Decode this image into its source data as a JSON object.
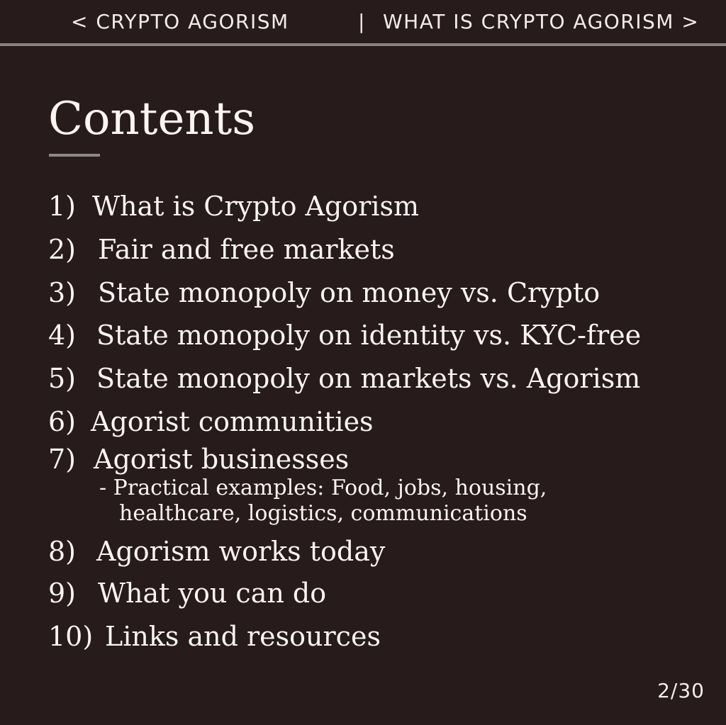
{
  "nav": {
    "prev_label": "< CRYPTO AGORISM",
    "separator": "|",
    "next_label": "WHAT IS CRYPTO AGORISM >"
  },
  "page_title": "Contents",
  "toc": [
    {
      "num": "1)",
      "label": "What is Crypto Agorism"
    },
    {
      "num": "2)",
      "label": "Fair and free markets"
    },
    {
      "num": "3)",
      "label": "State monopoly on money vs. Crypto"
    },
    {
      "num": "4)",
      "label": "State monopoly on identity vs. KYC-free"
    },
    {
      "num": "5)",
      "label": "State monopoly on markets vs. Agorism"
    },
    {
      "num": "6)",
      "label": "Agorist communities"
    },
    {
      "num": "7)",
      "label": "Agorist businesses"
    },
    {
      "num": "8)",
      "label": "Agorism works today"
    },
    {
      "num": "9)",
      "label": "What you can do"
    },
    {
      "num": "10)",
      "label": "Links and resources"
    }
  ],
  "toc_sub": {
    "line1": "- Practical examples: Food, jobs, housing,",
    "line2": "healthcare, logistics, communications"
  },
  "page_counter": "2/30"
}
